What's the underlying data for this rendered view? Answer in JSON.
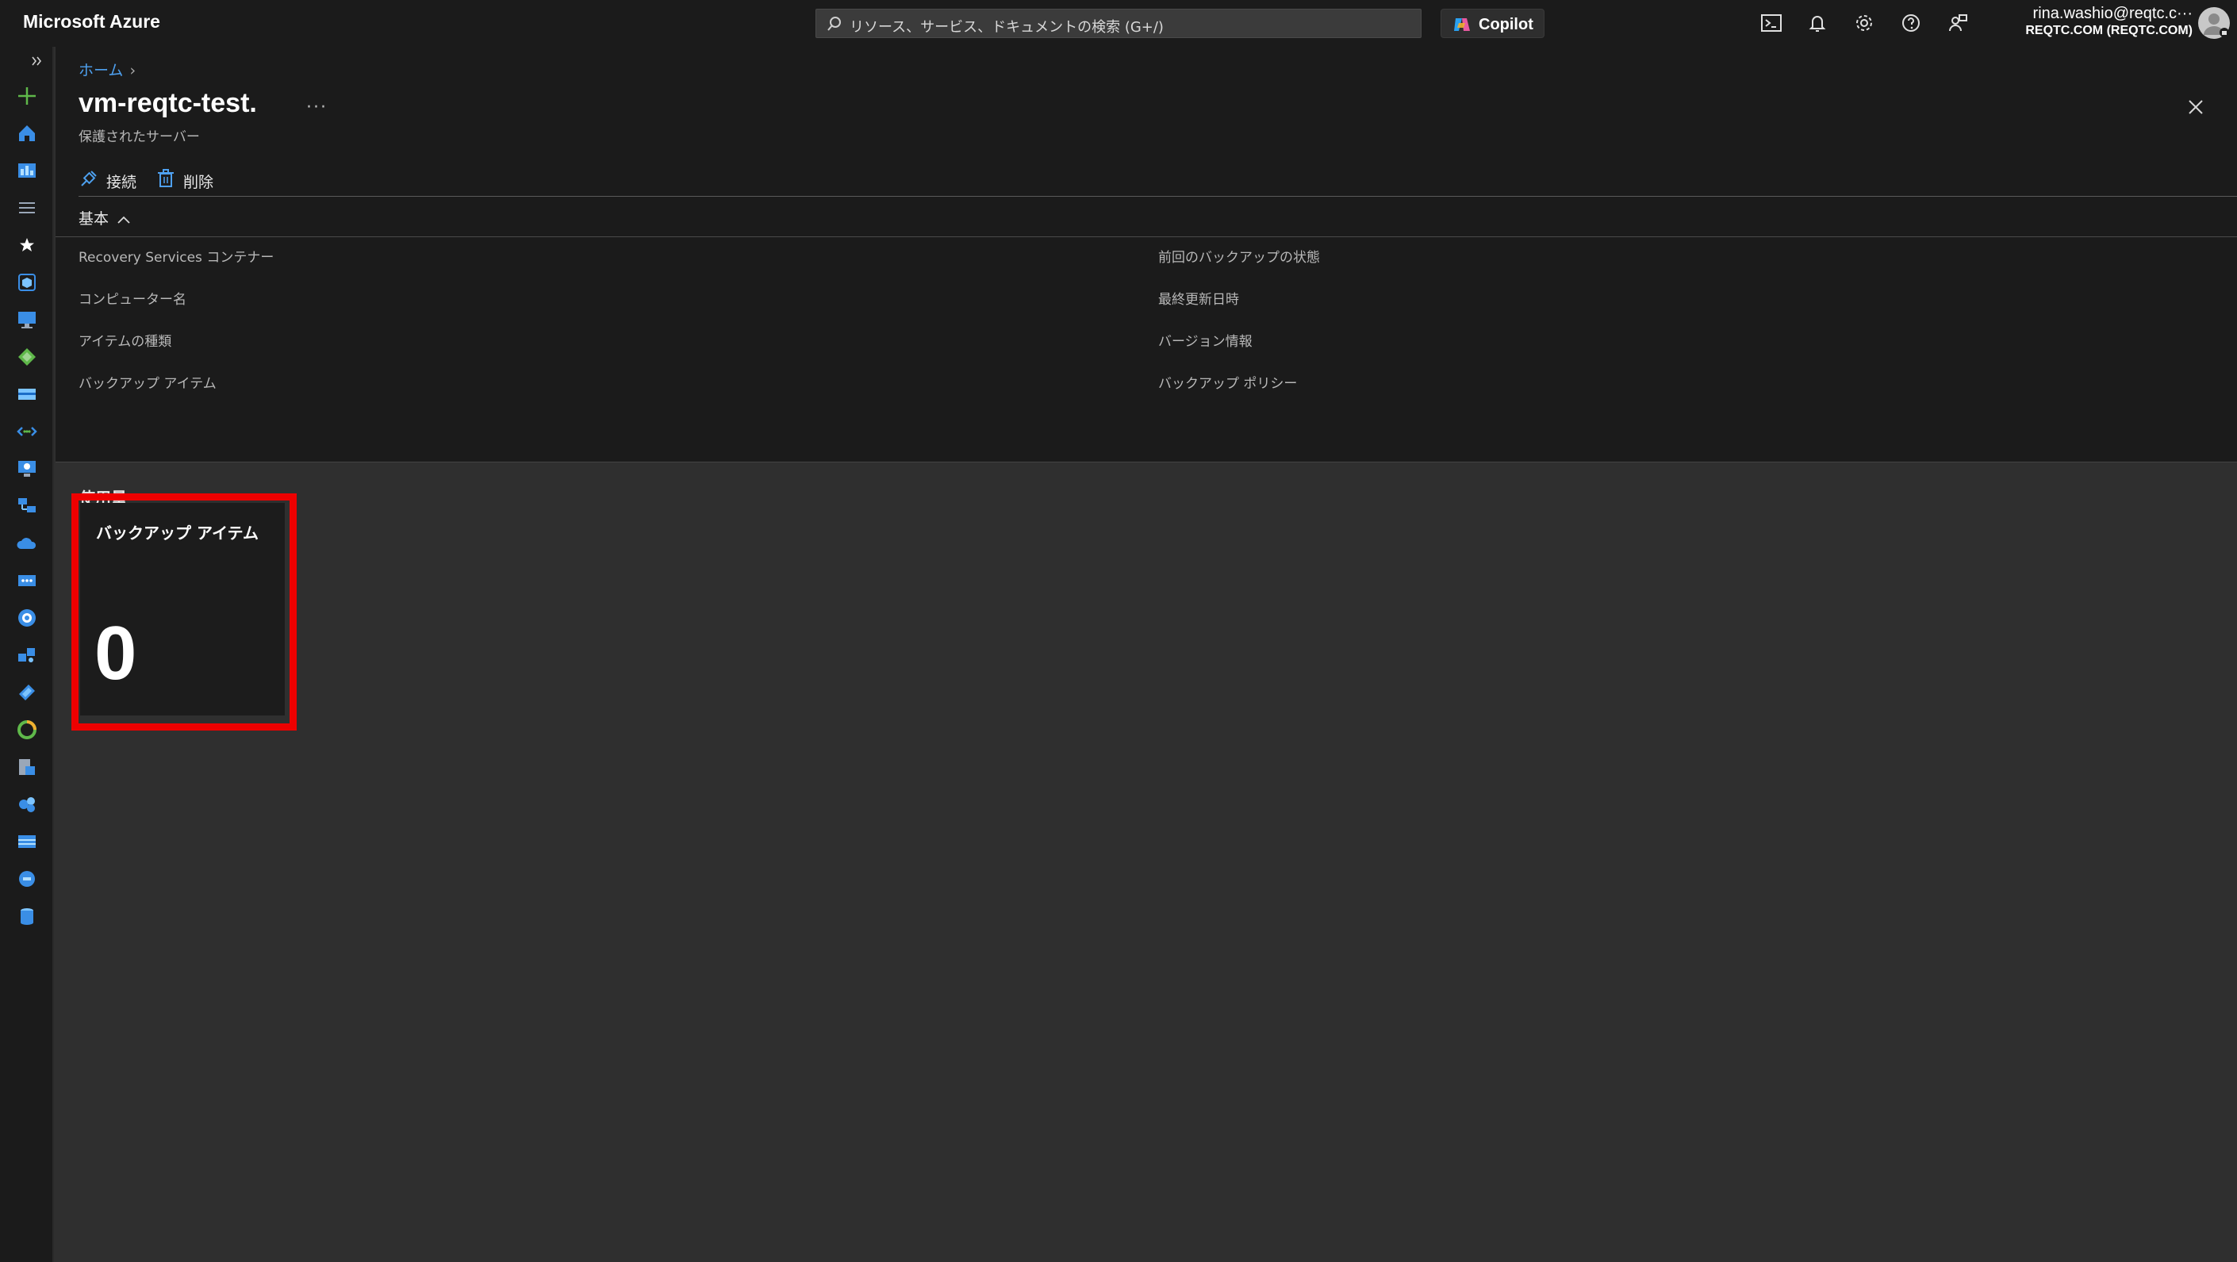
{
  "topbar": {
    "brand": "Microsoft Azure",
    "search_placeholder": "リソース、サービス、ドキュメントの検索 (G+/)",
    "copilot_label": "Copilot",
    "account_email": "rina.washio@reqtc.c···",
    "account_tenant": "REQTC.COM (REQTC.COM)",
    "icons": [
      "cloud-shell-icon",
      "notifications-icon",
      "settings-icon",
      "help-icon",
      "feedback-icon"
    ]
  },
  "rail": {
    "expand_icon": "chevron-double-right-icon",
    "items": [
      "create-resource",
      "home",
      "dashboard",
      "all-services",
      "favorites",
      "resource-groups",
      "virtual-machines",
      "app-services",
      "storage-accounts",
      "virtual-networks",
      "monitor",
      "sql",
      "cloud-services",
      "load-balancers",
      "advisor",
      "key-vault",
      "azure-ad",
      "defender",
      "recovery-vault",
      "policy",
      "storage",
      "cost",
      "database"
    ]
  },
  "blade": {
    "breadcrumb_home": "ホーム",
    "title": "vm-reqtc-test.",
    "more": "···",
    "subtitle": "保護されたサーバー",
    "commands": {
      "connect": "接続",
      "delete": "削除"
    },
    "essentials_label": "基本",
    "properties_left": [
      "Recovery Services コンテナー",
      "コンピューター名",
      "アイテムの種類",
      "バックアップ アイテム"
    ],
    "properties_right": [
      "前回のバックアップの状態",
      "最終更新日時",
      "バージョン情報",
      "バックアップ ポリシー"
    ]
  },
  "usage": {
    "section_title": "使用量",
    "tile": {
      "label": "バックアップ アイテム",
      "value": "0"
    }
  },
  "colors": {
    "accent": "#4ea0ef",
    "highlight": "#ee0000",
    "topbar_bg": "#1b1b1b",
    "content_bg": "#2f2f2f"
  }
}
